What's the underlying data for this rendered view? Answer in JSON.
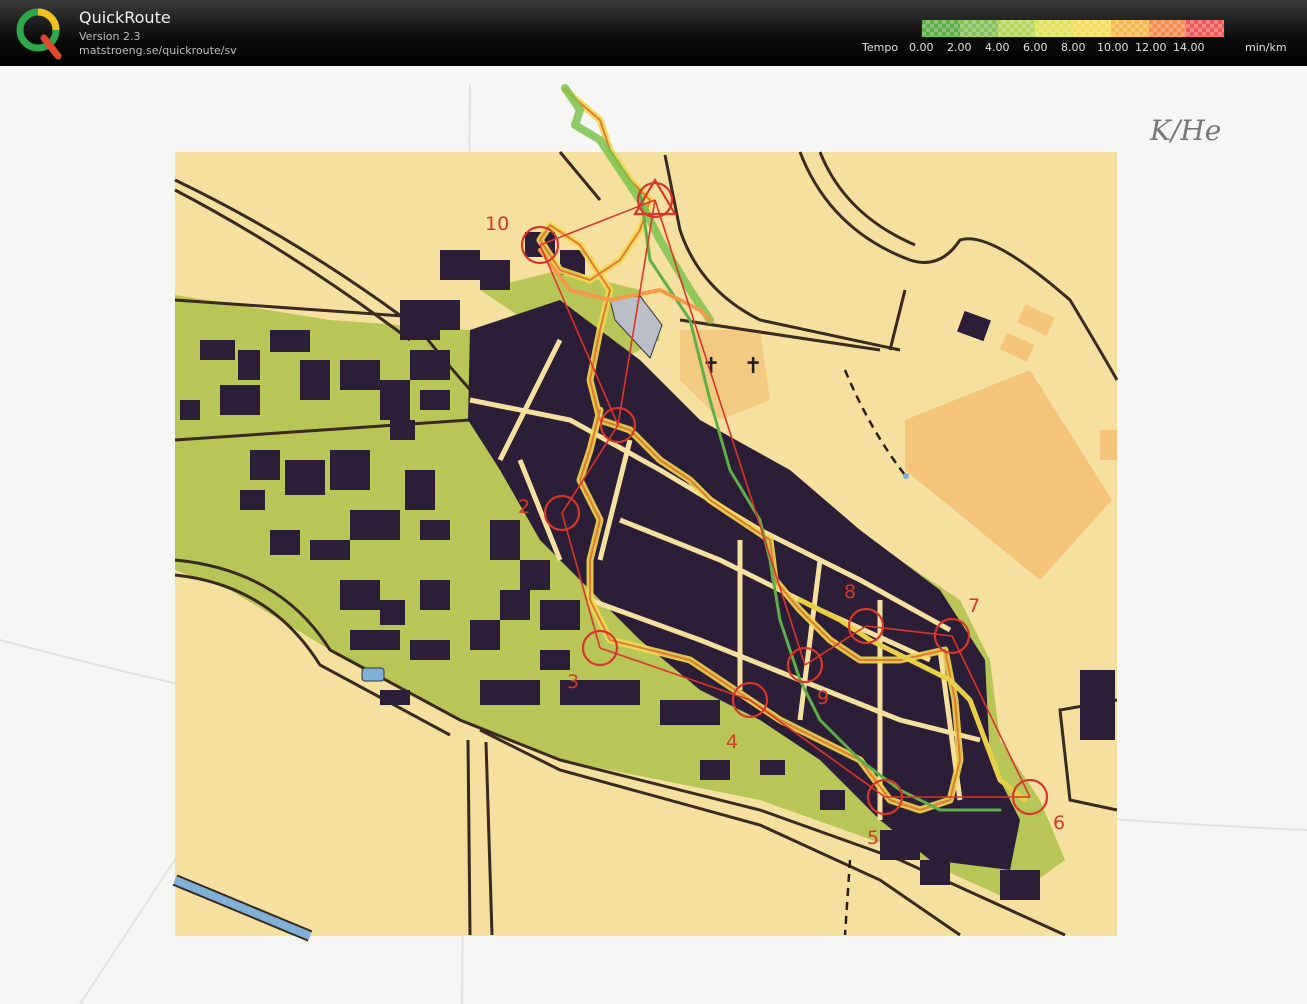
{
  "app": {
    "title": "QuickRoute",
    "version": "Version 2.3",
    "url": "matstroeng.se/quickroute/sv"
  },
  "legend": {
    "label": "Tempo",
    "ticks": [
      "0.00",
      "2.00",
      "4.00",
      "6.00",
      "8.00",
      "10.00",
      "12.00",
      "14.00"
    ],
    "unit": "min/km",
    "colors": [
      "#5fae4a",
      "#86c15a",
      "#b6d65c",
      "#dfe25a",
      "#f5dc5a",
      "#f5b84e",
      "#f28c50",
      "#ee5b5b"
    ]
  },
  "map": {
    "handwriting": "K/He",
    "controls": [
      {
        "label": "2"
      },
      {
        "label": "3"
      },
      {
        "label": "4"
      },
      {
        "label": "5"
      },
      {
        "label": "6"
      },
      {
        "label": "7"
      },
      {
        "label": "8"
      },
      {
        "label": "9"
      },
      {
        "label": "10"
      }
    ],
    "colors": {
      "paper": "#f7f7f5",
      "open": "#f6e0a0",
      "green": "#b9c75a",
      "building": "#2b1e36",
      "road": "#3a2a20",
      "course": "#d9362b"
    }
  }
}
